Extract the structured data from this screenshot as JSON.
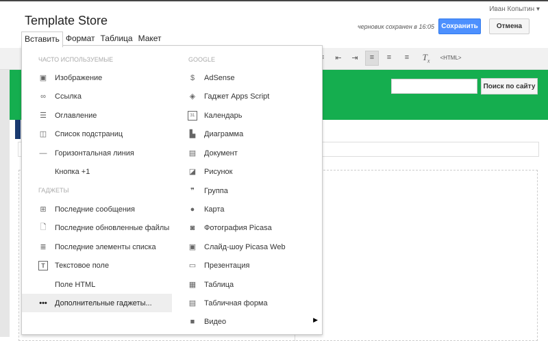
{
  "header": {
    "title": "Template Store",
    "user": "Иван Копытин ▾",
    "draft_status": "черновик сохранен в 16:05",
    "save_label": "Сохранить",
    "cancel_label": "Отмена"
  },
  "menubar": [
    "Вставить",
    "Формат",
    "Таблица",
    "Макет"
  ],
  "toolbar": {
    "html_label": "<HTML>"
  },
  "site": {
    "search_button": "Поиск по сайту",
    "search_value": ""
  },
  "insert_menu": {
    "left_header1": "ЧАСТО ИСПОЛЬЗУЕМЫЕ",
    "left_header2": "ГАДЖЕТЫ",
    "right_header": "GOOGLE",
    "left_items": [
      {
        "label": "Изображение",
        "icon": "image-icon"
      },
      {
        "label": "Ссылка",
        "icon": "link-icon"
      },
      {
        "label": "Оглавление",
        "icon": "toc-icon"
      },
      {
        "label": "Список подстраниц",
        "icon": "subpages-icon"
      },
      {
        "label": "Горизонтальная линия",
        "icon": "hr-icon"
      },
      {
        "label": "Кнопка +1",
        "icon": ""
      }
    ],
    "gadget_items": [
      {
        "label": "Последние сообщения",
        "icon": "posts-icon"
      },
      {
        "label": "Последние обновленные файлы",
        "icon": "files-icon"
      },
      {
        "label": "Последние элементы списка",
        "icon": "list-icon"
      },
      {
        "label": "Текстовое поле",
        "icon": "textbox-icon"
      },
      {
        "label": "Поле HTML",
        "icon": ""
      },
      {
        "label": "Дополнительные гаджеты...",
        "icon": "more-icon"
      }
    ],
    "right_items": [
      {
        "label": "AdSense",
        "icon": "dollar-icon"
      },
      {
        "label": "Гаджет Apps Script",
        "icon": "script-icon"
      },
      {
        "label": "Календарь",
        "icon": "calendar-icon"
      },
      {
        "label": "Диаграмма",
        "icon": "chart-icon"
      },
      {
        "label": "Документ",
        "icon": "document-icon"
      },
      {
        "label": "Рисунок",
        "icon": "drawing-icon"
      },
      {
        "label": "Группа",
        "icon": "group-icon"
      },
      {
        "label": "Карта",
        "icon": "map-pin-icon"
      },
      {
        "label": "Фотография Picasa",
        "icon": "camera-icon"
      },
      {
        "label": "Слайд-шоу Picasa Web",
        "icon": "slideshow-icon"
      },
      {
        "label": "Презентация",
        "icon": "presentation-icon"
      },
      {
        "label": "Таблица",
        "icon": "spreadsheet-icon"
      },
      {
        "label": "Табличная форма",
        "icon": "form-icon"
      },
      {
        "label": "Видео",
        "icon": "video-icon"
      }
    ]
  }
}
